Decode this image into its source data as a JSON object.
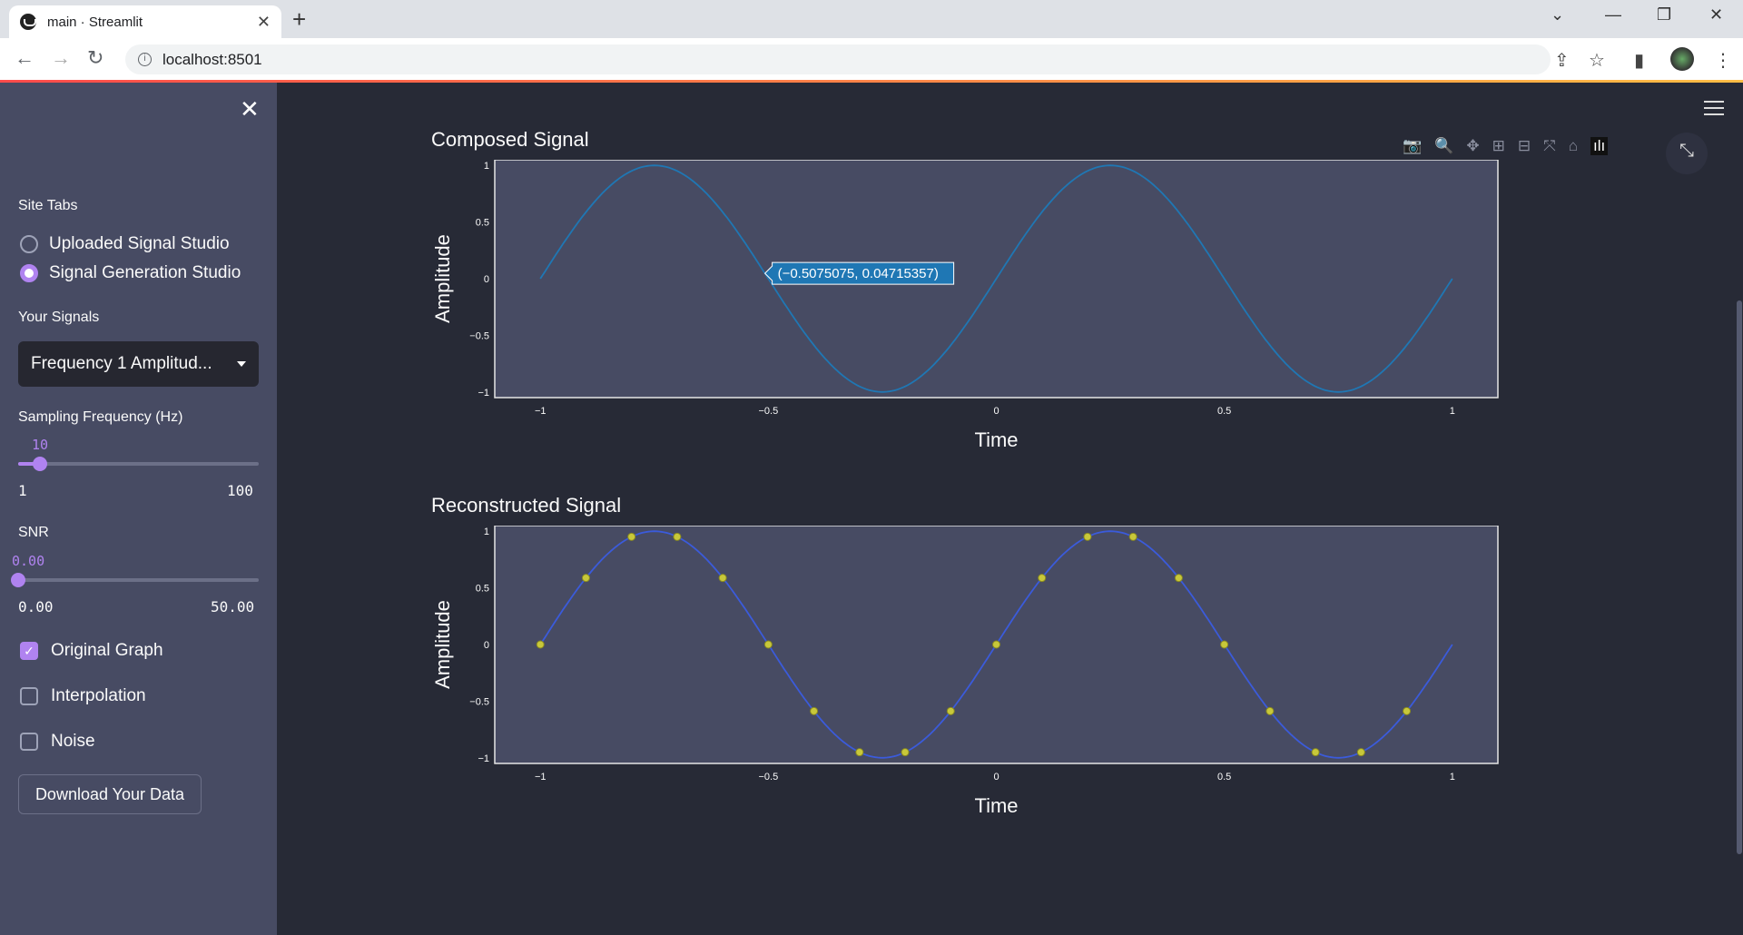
{
  "browser": {
    "tab_title": "main · Streamlit",
    "url": "localhost:8501"
  },
  "sidebar": {
    "site_tabs_label": "Site Tabs",
    "radio_options": [
      {
        "label": "Uploaded Signal Studio",
        "selected": false
      },
      {
        "label": "Signal Generation Studio",
        "selected": true
      }
    ],
    "your_signals_label": "Your Signals",
    "signal_select_value": "Frequency 1 Amplitud...",
    "sampling": {
      "label": "Sampling Frequency (Hz)",
      "value": "10",
      "min": "1",
      "max": "100",
      "fraction": 0.0909
    },
    "snr": {
      "label": "SNR",
      "value": "0.00",
      "min": "0.00",
      "max": "50.00",
      "fraction": 0
    },
    "checkboxes": [
      {
        "label": "Original Graph",
        "checked": true
      },
      {
        "label": "Interpolation",
        "checked": false
      },
      {
        "label": "Noise",
        "checked": false
      }
    ],
    "download_label": "Download Your Data"
  },
  "colors": {
    "accent": "#b083f0",
    "plot_bg": "#474b63",
    "composed_line": "#1f77b4",
    "reconstructed_line": "#3b5bdb",
    "sample_marker": "#c8c83a"
  },
  "chart_data": [
    {
      "type": "line",
      "title": "Composed Signal",
      "xlabel": "Time",
      "ylabel": "Amplitude",
      "xlim": [
        -1.1,
        1.1
      ],
      "ylim": [
        -1.05,
        1.05
      ],
      "xticks": [
        "−1",
        "−0.5",
        "0",
        "0.5",
        "1"
      ],
      "xtick_values": [
        -1,
        -0.5,
        0,
        0.5,
        1
      ],
      "yticks": [
        "1",
        "0.5",
        "0",
        "−0.5",
        "−1"
      ],
      "ytick_values": [
        1,
        0.5,
        0,
        -0.5,
        -1
      ],
      "series": [
        {
          "function": "sin(2*pi*1*t)",
          "x_range": [
            -1,
            1
          ]
        }
      ],
      "hover": {
        "text": "(−0.5075075, 0.04715357)",
        "x": -0.5075075,
        "y": 0.04715357
      }
    },
    {
      "type": "line",
      "title": "Reconstructed Signal",
      "xlabel": "Time",
      "ylabel": "Amplitude",
      "xlim": [
        -1.1,
        1.1
      ],
      "ylim": [
        -1.05,
        1.05
      ],
      "xticks": [
        "−1",
        "−0.5",
        "0",
        "0.5",
        "1"
      ],
      "xtick_values": [
        -1,
        -0.5,
        0,
        0.5,
        1
      ],
      "yticks": [
        "1",
        "0.5",
        "0",
        "−0.5",
        "−1"
      ],
      "ytick_values": [
        1,
        0.5,
        0,
        -0.5,
        -1
      ],
      "series": [
        {
          "function": "sin(2*pi*1*t)",
          "x_range": [
            -1,
            1
          ]
        }
      ],
      "samples_x": [
        -1,
        -0.9,
        -0.8,
        -0.7,
        -0.6,
        -0.5,
        -0.4,
        -0.3,
        -0.2,
        -0.1,
        0,
        0.1,
        0.2,
        0.3,
        0.4,
        0.5,
        0.6,
        0.7,
        0.8,
        0.9
      ],
      "samples_y": [
        0,
        0.588,
        0.951,
        0.951,
        0.588,
        0,
        -0.588,
        -0.951,
        -0.951,
        -0.588,
        0,
        0.588,
        0.951,
        0.951,
        0.588,
        0,
        -0.588,
        -0.951,
        -0.951,
        -0.588
      ]
    }
  ]
}
